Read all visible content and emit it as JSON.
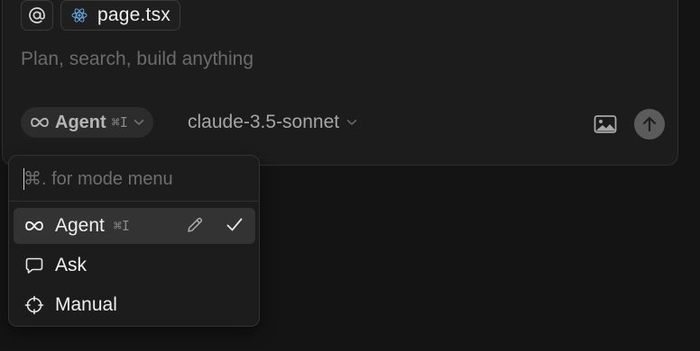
{
  "composer": {
    "mention_symbol": "@",
    "file_chip": {
      "label": "page.tsx",
      "icon": "react-icon"
    },
    "prompt_placeholder": "Plan, search, build anything",
    "mode_pill": {
      "label": "Agent",
      "shortcut": "⌘I",
      "icon": "infinity-icon"
    },
    "model": {
      "label": "claude-3.5-sonnet"
    },
    "icons": {
      "image": "image-icon",
      "send": "arrow-up-icon"
    }
  },
  "mode_menu": {
    "search_placeholder": "⌘. for mode menu",
    "items": [
      {
        "label": "Agent",
        "shortcut": "⌘I",
        "icon": "infinity-icon",
        "selected": true
      },
      {
        "label": "Ask",
        "icon": "chat-bubble-icon",
        "selected": false
      },
      {
        "label": "Manual",
        "icon": "crosshair-icon",
        "selected": false
      }
    ]
  },
  "colors": {
    "background": "#141414",
    "panel": "#1c1c1c",
    "selected_row": "#333333",
    "send_button": "#5b5b5b",
    "react_blue": "#61a0d8"
  }
}
